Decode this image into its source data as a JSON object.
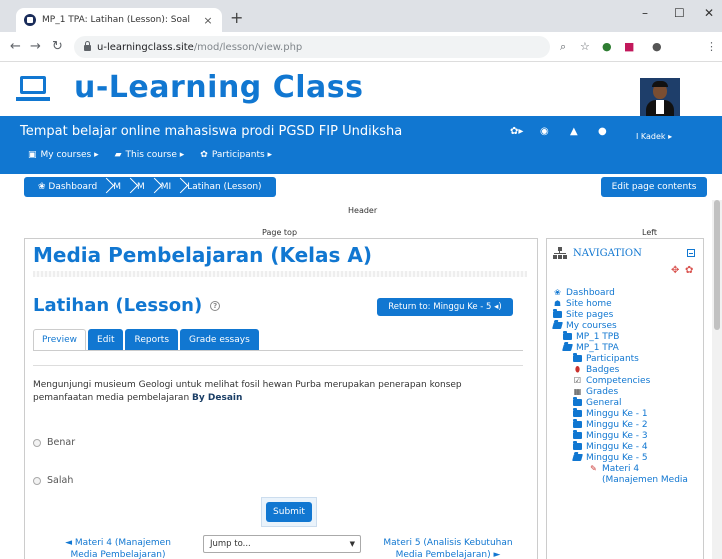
{
  "browser": {
    "tab_title": "MP_1 TPA: Latihan (Lesson): Soal",
    "tab_close": "×",
    "new_tab": "+",
    "minimize": "–",
    "maximize": "☐",
    "close": "✕",
    "url_host": "u-learningclass.site",
    "url_path": "/mod/lesson/view.php"
  },
  "site": {
    "name": "u-Learning Class",
    "tagline": "Tempat belajar online mahasiswa prodi PGSD FIP Undiksha",
    "user_name": "I Kadek ▸"
  },
  "menu": [
    {
      "icon": "▣",
      "label": "My courses ▸"
    },
    {
      "icon": "▰",
      "label": "This course ▸"
    },
    {
      "icon": "✿",
      "label": "Participants ▸"
    }
  ],
  "breadcrumb": [
    "❀ Dashboard",
    "M",
    "M",
    "MI",
    "Latihan (Lesson)"
  ],
  "edit_page": "Edit page contents",
  "labels": {
    "header": "Header",
    "page_top": "Page top",
    "left": "Left"
  },
  "main": {
    "course_title": "Media Pembelajaran (Kelas A)",
    "lesson_title": "Latihan (Lesson)",
    "help": "?",
    "return_btn": "Return to: Minggu Ke - 5 ◂)",
    "tabs": [
      "Preview",
      "Edit",
      "Reports",
      "Grade essays"
    ],
    "question_text": "Mengunjungi musieum Geologi untuk melihat fosil hewan Purba merupakan penerapan konsep pemanfaatan media pembelajaran ",
    "question_bold": "By Desain",
    "options": [
      "Benar",
      "Salah"
    ],
    "submit": "Submit",
    "prev_link": "◄ Materi 4 (Manajemen Media Pembelajaran)",
    "jump_placeholder": "Jump to...",
    "jump_arrow": "▼",
    "next_link": "Materi 5 (Analisis Kebutuhan Media Pembelajaran) ►"
  },
  "navigation": {
    "title": "NAVIGATION",
    "move": "✥",
    "gear": "✿",
    "items": [
      {
        "label": "Dashboard",
        "icon": "❀",
        "indent": 0,
        "type": "icon"
      },
      {
        "label": "Site home",
        "icon": "☗",
        "indent": 0,
        "type": "icon"
      },
      {
        "label": "Site pages",
        "icon": "",
        "indent": 0,
        "type": "folder"
      },
      {
        "label": "My courses",
        "icon": "",
        "indent": 0,
        "type": "folder-open"
      },
      {
        "label": "MP_1 TPB",
        "icon": "",
        "indent": 1,
        "type": "folder"
      },
      {
        "label": "MP_1 TPA",
        "icon": "",
        "indent": 1,
        "type": "folder-open"
      },
      {
        "label": "Participants",
        "icon": "",
        "indent": 2,
        "type": "folder"
      },
      {
        "label": "Badges",
        "icon": "⬮",
        "indent": 2,
        "type": "icon-red"
      },
      {
        "label": "Competencies",
        "icon": "☑",
        "indent": 2,
        "type": "icon-dark"
      },
      {
        "label": "Grades",
        "icon": "▦",
        "indent": 2,
        "type": "icon-dark"
      },
      {
        "label": "General",
        "icon": "",
        "indent": 2,
        "type": "folder"
      },
      {
        "label": "Minggu Ke - 1",
        "icon": "",
        "indent": 2,
        "type": "folder"
      },
      {
        "label": "Minggu Ke - 2",
        "icon": "",
        "indent": 2,
        "type": "folder"
      },
      {
        "label": "Minggu Ke - 3",
        "icon": "",
        "indent": 2,
        "type": "folder"
      },
      {
        "label": "Minggu Ke - 4",
        "icon": "",
        "indent": 2,
        "type": "folder"
      },
      {
        "label": "Minggu Ke - 5",
        "icon": "",
        "indent": 2,
        "type": "folder-open"
      },
      {
        "label": "Materi 4",
        "icon": "✎",
        "indent": 3,
        "type": "icon-red"
      },
      {
        "label": "(Manajemen Media",
        "icon": "",
        "indent": 3,
        "type": "text"
      }
    ]
  }
}
